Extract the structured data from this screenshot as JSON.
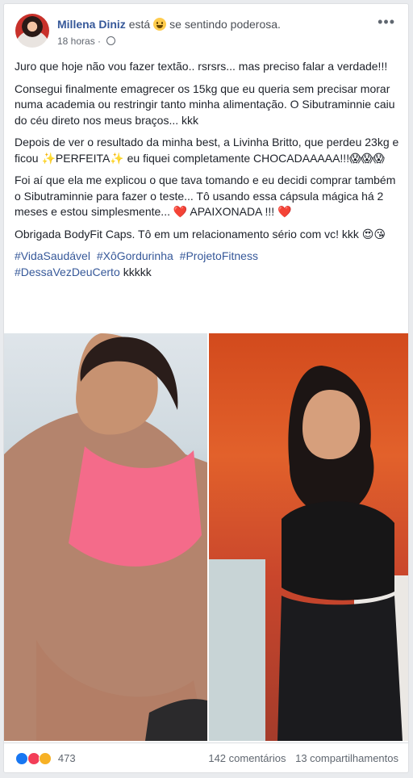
{
  "post": {
    "author": "Millena Diniz",
    "feeling_prefix": "está",
    "feeling_text": "se sentindo poderosa.",
    "timestamp": "18 horas",
    "privacy_icon": "globe-icon",
    "menu_icon": "more-icon",
    "menu_label": "•••"
  },
  "content": {
    "paragraphs": [
      "Juro que hoje não vou fazer textão.. rsrsrs... mas preciso falar a verdade!!!",
      "Consegui finalmente emagrecer os 15kg que eu queria sem precisar morar numa academia ou restringir tanto minha alimentação. O Sibutraminnie caiu do céu direto nos meus braços... kkk",
      "Depois de ver o resultado da minha best, a Livinha Britto, que perdeu 23kg e ficou ✨PERFEITA✨ eu fiquei completamente CHOCADAAAAA!!!😱😱😱",
      "Foi aí que ela me explicou o que tava tomando e eu decidi comprar também o Sibutraminnie para fazer o teste... Tô usando essa cápsula mágica há 2 meses e estou simplesmente... ❤️ APAIXONADA !!! ❤️",
      "Obrigada BodyFit Caps. Tô em um relacionamento sério com vc! kkk 😍😘"
    ],
    "hashtags": [
      "#VidaSaudável",
      "#XôGordurinha",
      "#ProjetoFitness",
      "#DessaVezDeuCerto"
    ],
    "hashtag_suffix": "kkkkk"
  },
  "images": {
    "left_alt": "before photo",
    "right_alt": "after photo"
  },
  "footer": {
    "reaction_icons": [
      "like-icon",
      "love-icon",
      "wow-icon"
    ],
    "reaction_count": "473",
    "comments": "142 comentários",
    "shares": "13 compartilhamentos"
  },
  "colors": {
    "link": "#365899",
    "background": "#e9ebee",
    "card": "#ffffff"
  }
}
